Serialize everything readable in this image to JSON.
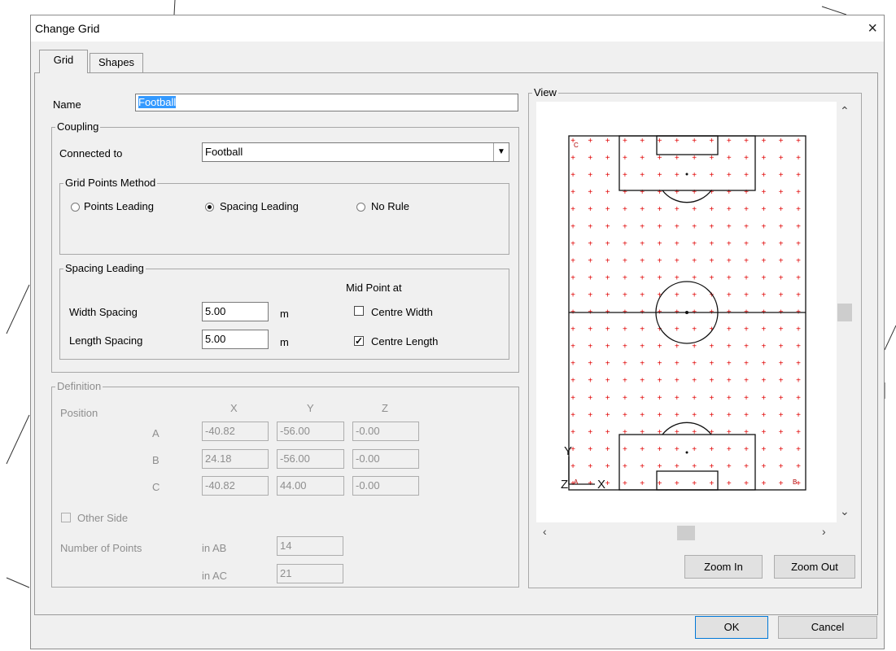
{
  "dialog": {
    "title": "Change Grid",
    "close_icon": "×"
  },
  "tabs": [
    {
      "label": "Grid"
    },
    {
      "label": "Shapes"
    }
  ],
  "name": {
    "label": "Name",
    "value": "Football"
  },
  "coupling": {
    "title": "Coupling",
    "connected_label": "Connected to",
    "connected_value": "Football",
    "method": {
      "title": "Grid Points Method",
      "options": [
        "Points Leading",
        "Spacing Leading",
        "No Rule"
      ],
      "selected": "Spacing Leading"
    },
    "spacing": {
      "title": "Spacing Leading",
      "width_label": "Width Spacing",
      "width_value": "5.00",
      "length_label": "Length Spacing",
      "length_value": "5.00",
      "unit": "m",
      "mid_label": "Mid Point at",
      "centre_width_label": "Centre Width",
      "centre_width_checked": false,
      "centre_length_label": "Centre Length",
      "centre_length_checked": true
    }
  },
  "definition": {
    "title": "Definition",
    "position_label": "Position",
    "headers": [
      "X",
      "Y",
      "Z"
    ],
    "rows": [
      {
        "label": "A",
        "x": "-40.82",
        "y": "-56.00",
        "z": "-0.00"
      },
      {
        "label": "B",
        "x": "24.18",
        "y": "-56.00",
        "z": "-0.00"
      },
      {
        "label": "C",
        "x": "-40.82",
        "y": "44.00",
        "z": "-0.00"
      }
    ],
    "other_side_label": "Other Side",
    "points_label": "Number of Points",
    "in_ab_label": "in AB",
    "in_ab_value": "14",
    "in_ac_label": "in AC",
    "in_ac_value": "21"
  },
  "view": {
    "title": "View",
    "zoom_in": "Zoom In",
    "zoom_out": "Zoom Out",
    "axis_y": "Y",
    "axis_z": "Z",
    "axis_x": "X",
    "corner_c": "C",
    "corner_a": "A",
    "corner_b": "B",
    "grid_color": "#e00000",
    "grid_cols": 14,
    "grid_rows": 21
  },
  "footer": {
    "ok": "OK",
    "cancel": "Cancel"
  }
}
